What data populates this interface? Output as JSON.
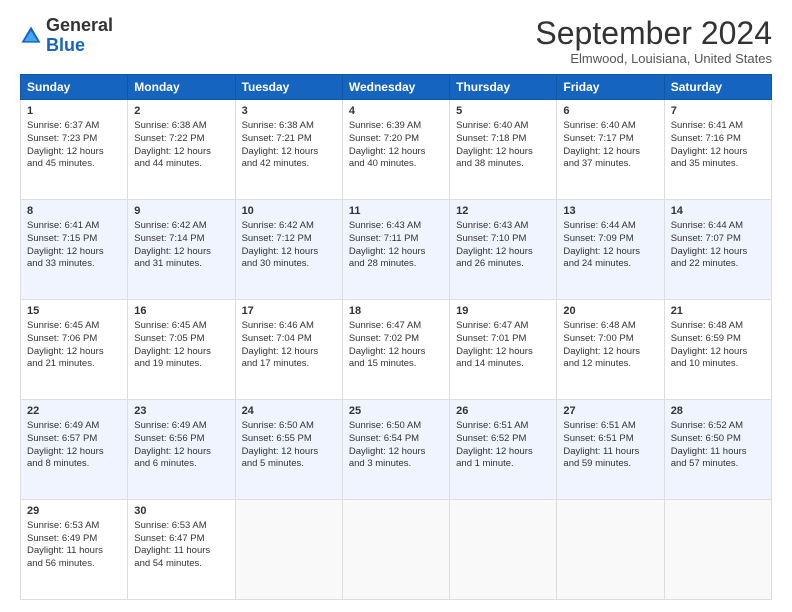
{
  "header": {
    "logo_general": "General",
    "logo_blue": "Blue",
    "month_title": "September 2024",
    "location": "Elmwood, Louisiana, United States"
  },
  "weekdays": [
    "Sunday",
    "Monday",
    "Tuesday",
    "Wednesday",
    "Thursday",
    "Friday",
    "Saturday"
  ],
  "weeks": [
    [
      {
        "day": "1",
        "sunrise": "6:37 AM",
        "sunset": "7:23 PM",
        "daylight": "12 hours and 45 minutes."
      },
      {
        "day": "2",
        "sunrise": "6:38 AM",
        "sunset": "7:22 PM",
        "daylight": "12 hours and 44 minutes."
      },
      {
        "day": "3",
        "sunrise": "6:38 AM",
        "sunset": "7:21 PM",
        "daylight": "12 hours and 42 minutes."
      },
      {
        "day": "4",
        "sunrise": "6:39 AM",
        "sunset": "7:20 PM",
        "daylight": "12 hours and 40 minutes."
      },
      {
        "day": "5",
        "sunrise": "6:40 AM",
        "sunset": "7:18 PM",
        "daylight": "12 hours and 38 minutes."
      },
      {
        "day": "6",
        "sunrise": "6:40 AM",
        "sunset": "7:17 PM",
        "daylight": "12 hours and 37 minutes."
      },
      {
        "day": "7",
        "sunrise": "6:41 AM",
        "sunset": "7:16 PM",
        "daylight": "12 hours and 35 minutes."
      }
    ],
    [
      {
        "day": "8",
        "sunrise": "6:41 AM",
        "sunset": "7:15 PM",
        "daylight": "12 hours and 33 minutes."
      },
      {
        "day": "9",
        "sunrise": "6:42 AM",
        "sunset": "7:14 PM",
        "daylight": "12 hours and 31 minutes."
      },
      {
        "day": "10",
        "sunrise": "6:42 AM",
        "sunset": "7:12 PM",
        "daylight": "12 hours and 30 minutes."
      },
      {
        "day": "11",
        "sunrise": "6:43 AM",
        "sunset": "7:11 PM",
        "daylight": "12 hours and 28 minutes."
      },
      {
        "day": "12",
        "sunrise": "6:43 AM",
        "sunset": "7:10 PM",
        "daylight": "12 hours and 26 minutes."
      },
      {
        "day": "13",
        "sunrise": "6:44 AM",
        "sunset": "7:09 PM",
        "daylight": "12 hours and 24 minutes."
      },
      {
        "day": "14",
        "sunrise": "6:44 AM",
        "sunset": "7:07 PM",
        "daylight": "12 hours and 22 minutes."
      }
    ],
    [
      {
        "day": "15",
        "sunrise": "6:45 AM",
        "sunset": "7:06 PM",
        "daylight": "12 hours and 21 minutes."
      },
      {
        "day": "16",
        "sunrise": "6:45 AM",
        "sunset": "7:05 PM",
        "daylight": "12 hours and 19 minutes."
      },
      {
        "day": "17",
        "sunrise": "6:46 AM",
        "sunset": "7:04 PM",
        "daylight": "12 hours and 17 minutes."
      },
      {
        "day": "18",
        "sunrise": "6:47 AM",
        "sunset": "7:02 PM",
        "daylight": "12 hours and 15 minutes."
      },
      {
        "day": "19",
        "sunrise": "6:47 AM",
        "sunset": "7:01 PM",
        "daylight": "12 hours and 14 minutes."
      },
      {
        "day": "20",
        "sunrise": "6:48 AM",
        "sunset": "7:00 PM",
        "daylight": "12 hours and 12 minutes."
      },
      {
        "day": "21",
        "sunrise": "6:48 AM",
        "sunset": "6:59 PM",
        "daylight": "12 hours and 10 minutes."
      }
    ],
    [
      {
        "day": "22",
        "sunrise": "6:49 AM",
        "sunset": "6:57 PM",
        "daylight": "12 hours and 8 minutes."
      },
      {
        "day": "23",
        "sunrise": "6:49 AM",
        "sunset": "6:56 PM",
        "daylight": "12 hours and 6 minutes."
      },
      {
        "day": "24",
        "sunrise": "6:50 AM",
        "sunset": "6:55 PM",
        "daylight": "12 hours and 5 minutes."
      },
      {
        "day": "25",
        "sunrise": "6:50 AM",
        "sunset": "6:54 PM",
        "daylight": "12 hours and 3 minutes."
      },
      {
        "day": "26",
        "sunrise": "6:51 AM",
        "sunset": "6:52 PM",
        "daylight": "12 hours and 1 minute."
      },
      {
        "day": "27",
        "sunrise": "6:51 AM",
        "sunset": "6:51 PM",
        "daylight": "11 hours and 59 minutes."
      },
      {
        "day": "28",
        "sunrise": "6:52 AM",
        "sunset": "6:50 PM",
        "daylight": "11 hours and 57 minutes."
      }
    ],
    [
      {
        "day": "29",
        "sunrise": "6:53 AM",
        "sunset": "6:49 PM",
        "daylight": "11 hours and 56 minutes."
      },
      {
        "day": "30",
        "sunrise": "6:53 AM",
        "sunset": "6:47 PM",
        "daylight": "11 hours and 54 minutes."
      },
      null,
      null,
      null,
      null,
      null
    ]
  ],
  "labels": {
    "sunrise": "Sunrise:",
    "sunset": "Sunset:",
    "daylight": "Daylight:"
  }
}
